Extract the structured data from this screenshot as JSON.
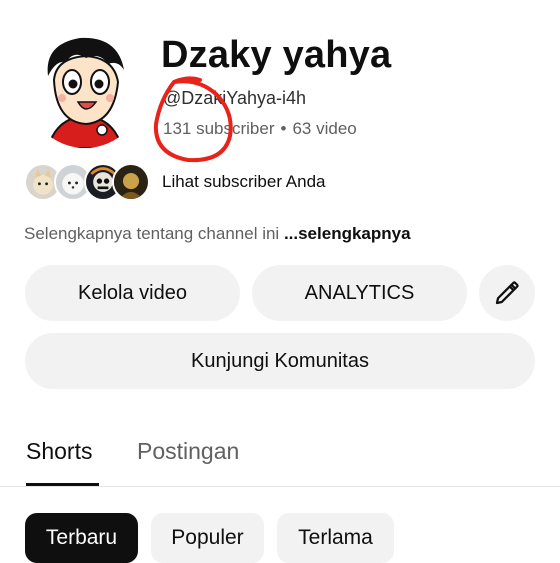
{
  "channel": {
    "name": "Dzaky yahya",
    "handle": "@DzakiYahya-i4h",
    "subscribers": "131 subscriber",
    "separator": "•",
    "videos": "63 video"
  },
  "subscribers_row": {
    "label": "Lihat subscriber Anda"
  },
  "description": {
    "text": "Selengkapnya tentang channel ini ",
    "more_label": "...selengkapnya"
  },
  "actions": {
    "manage_videos": "Kelola video",
    "analytics": "ANALYTICS",
    "visit_community": "Kunjungi Komunitas"
  },
  "tabs": [
    {
      "label": "Shorts",
      "active": true
    },
    {
      "label": "Postingan",
      "active": false
    }
  ],
  "filters": [
    {
      "label": "Terbaru",
      "selected": true
    },
    {
      "label": "Populer",
      "selected": false
    },
    {
      "label": "Terlama",
      "selected": false
    }
  ],
  "icons": {
    "edit": "pencil-icon"
  },
  "colors": {
    "annotation": "#e8231a",
    "chip_selected_bg": "#0f0f0f",
    "pill_bg": "#f2f2f2",
    "secondary_text": "#606060"
  }
}
